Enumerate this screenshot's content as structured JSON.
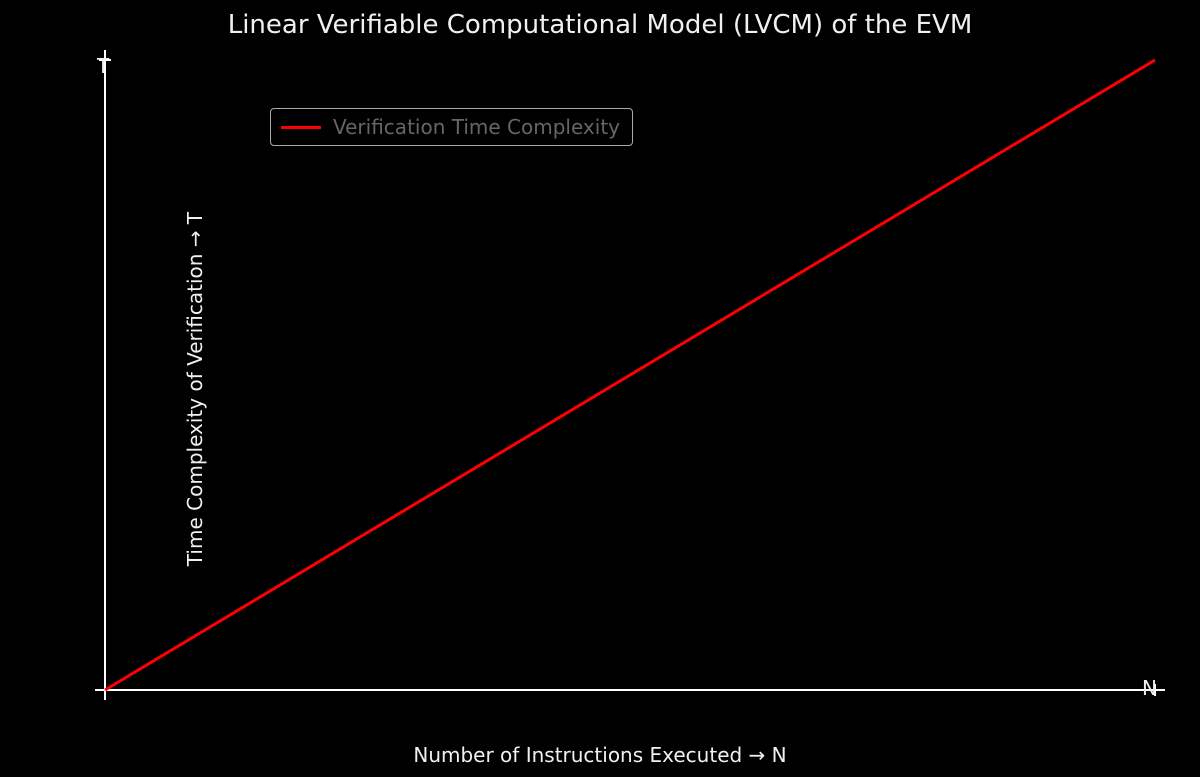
{
  "chart_data": {
    "type": "line",
    "title": "Linear Verifiable Computational Model (LVCM) of the EVM",
    "xlabel": "Number of Instructions Executed → N",
    "ylabel": "Time Complexity of Verification → T",
    "axis_end_labels": {
      "x": "N",
      "y": "T"
    },
    "series": [
      {
        "name": "Verification Time Complexity",
        "color": "#ff0000",
        "x": [
          0,
          1
        ],
        "y": [
          0,
          1
        ]
      }
    ],
    "xlim": [
      0,
      1
    ],
    "ylim": [
      0,
      1
    ],
    "grid": false,
    "legend_position": "upper-left"
  },
  "colors": {
    "background": "#000000",
    "axis": "#ffffff",
    "text": "#f0f0f0",
    "legend_text": "#666666",
    "line": "#ff0000"
  }
}
